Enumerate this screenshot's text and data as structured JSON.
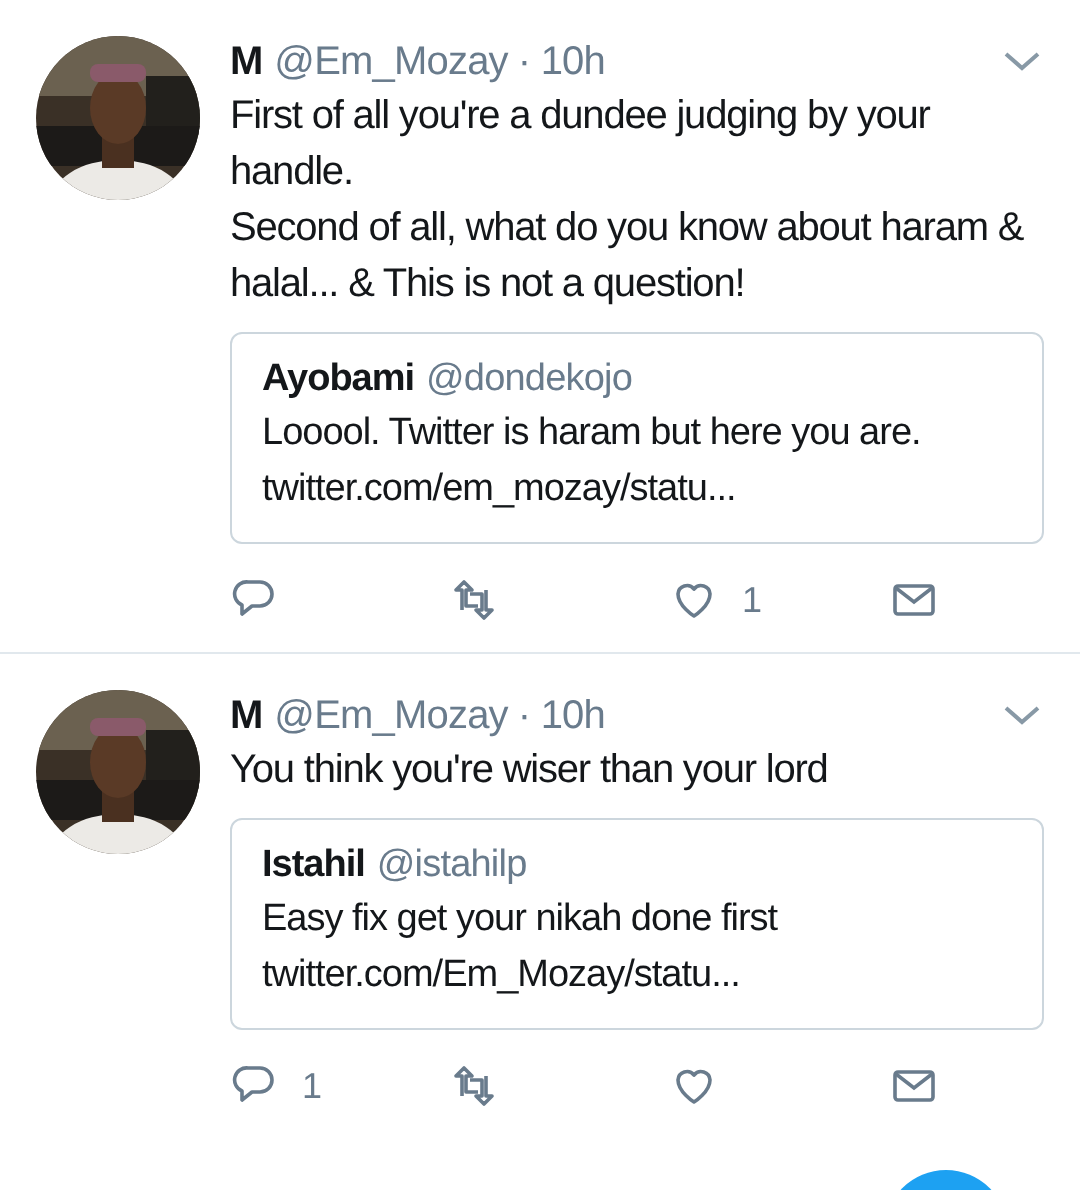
{
  "tweets": [
    {
      "name": "M",
      "handle": "@Em_Mozay",
      "time": "· 10h",
      "text": "First of all you're a dundee judging by your handle.\nSecond of all, what do you know about haram & halal... & This is not a question!",
      "quote": {
        "name": "Ayobami",
        "handle": "@dondekojo",
        "text": "Looool. Twitter is haram but here you are. twitter.com/em_mozay/statu..."
      },
      "actions": [
        {
          "kind": "reply"
        },
        {
          "kind": "retweet"
        },
        {
          "kind": "like",
          "count": "1"
        },
        {
          "kind": "message"
        }
      ]
    },
    {
      "name": "M",
      "handle": "@Em_Mozay",
      "time": "· 10h",
      "text": "You think you're wiser than your lord",
      "quote": {
        "name": "Istahil",
        "handle": "@istahilp",
        "text": "Easy fix get your nikah done first\ntwitter.com/Em_Mozay/statu..."
      },
      "actions": [
        {
          "kind": "reply",
          "count": "1"
        },
        {
          "kind": "retweet"
        },
        {
          "kind": "like"
        },
        {
          "kind": "message"
        }
      ]
    }
  ]
}
